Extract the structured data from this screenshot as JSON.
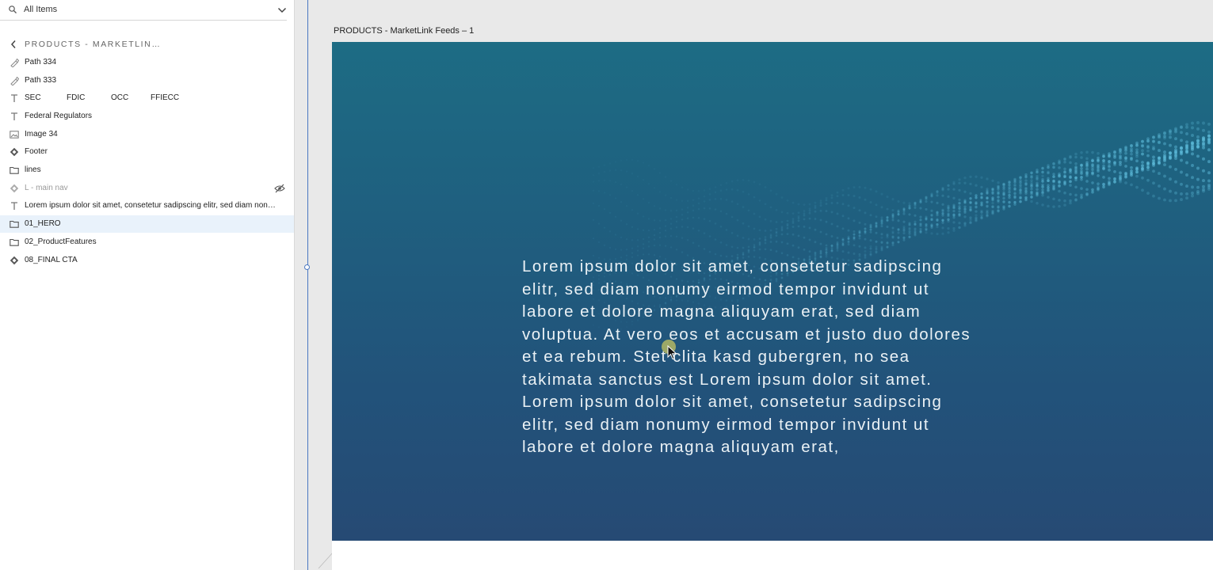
{
  "search": {
    "value": "All Items"
  },
  "panel": {
    "title": "PRODUCTS - MARKETLIN…"
  },
  "layers": {
    "path334": "Path 334",
    "path333": "Path 333",
    "text_row": {
      "sec": "SEC",
      "fdic": "FDIC",
      "occ": "OCC",
      "ffiecc": "FFIECC"
    },
    "federal_regulators": "Federal Regulators",
    "image34": "Image 34",
    "footer": "Footer",
    "lines": "lines",
    "main_nav": "L - main nav",
    "lorem": "Lorem ipsum dolor sit amet, consetetur sadipscing elitr, sed diam nonumy",
    "hero": "01_HERO",
    "product_features": "02_ProductFeatures",
    "final_cta": "08_FINAL CTA"
  },
  "artboard": {
    "label": "PRODUCTS - MarketLink Feeds – 1"
  },
  "hero": {
    "paragraph": "Lorem ipsum dolor sit amet, consetetur sadipscing elitr, sed diam nonumy eirmod tempor invidunt ut labore et dolore magna aliquyam erat, sed diam voluptua. At vero eos et accusam et justo duo dolores et ea rebum. Stet clita kasd gubergren, no sea takimata sanctus est Lorem ipsum dolor sit amet. Lorem ipsum dolor sit amet, consetetur sadipscing elitr, sed diam nonumy eirmod tempor invidunt ut labore et dolore magna aliquyam erat,"
  },
  "colors": {
    "accent": "#4a78c2",
    "hero_top": "#1d6c84",
    "hero_bottom": "#264a74",
    "selection": "#e9f2fb"
  },
  "icons": {
    "search": "search-icon",
    "dropdown": "chevron-down-icon",
    "back": "chevron-left-icon",
    "path": "pen-path-icon",
    "text": "text-icon",
    "image": "image-icon",
    "component": "component-diamond-icon",
    "group": "folder-icon",
    "hidden": "eye-hidden-icon"
  }
}
